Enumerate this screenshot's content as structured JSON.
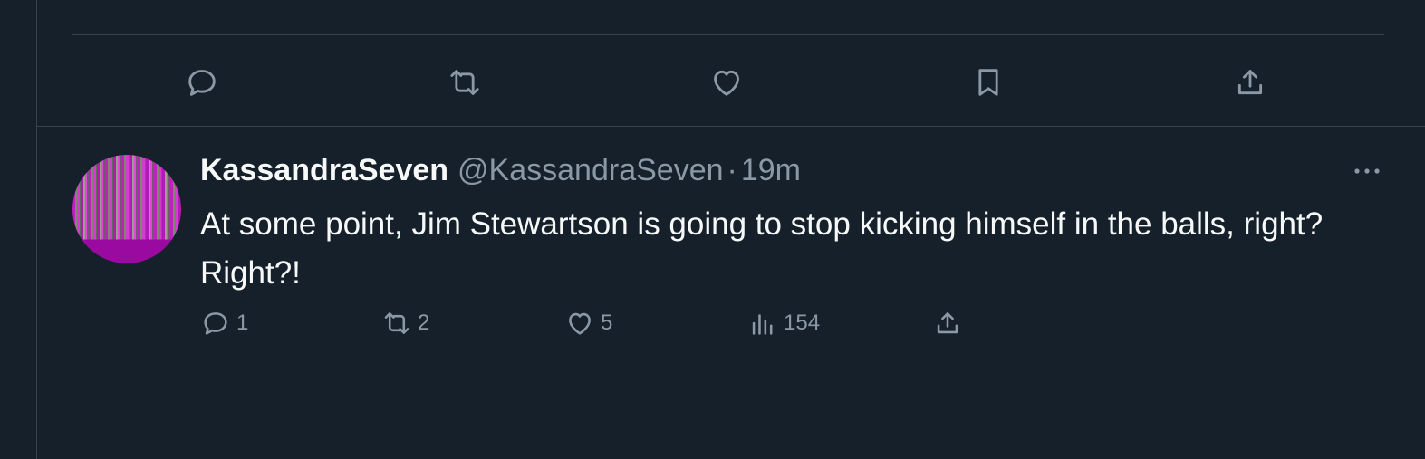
{
  "top_actions": [
    {
      "icon": "reply-icon"
    },
    {
      "icon": "retweet-icon"
    },
    {
      "icon": "like-icon"
    },
    {
      "icon": "bookmark-icon"
    },
    {
      "icon": "share-icon"
    }
  ],
  "tweet": {
    "display_name": "KassandraSeven",
    "handle": "@KassandraSeven",
    "separator": "·",
    "time": "19m",
    "more_label": "•••",
    "text": "At some point, Jim Stewartson is going to stop kicking himself in the balls, right? Right?!",
    "actions": {
      "replies": "1",
      "retweets": "2",
      "likes": "5",
      "views": "154"
    }
  },
  "colors": {
    "background": "#15202b",
    "border": "#38444d",
    "muted": "#8b98a5",
    "text": "#f7f9f9"
  }
}
